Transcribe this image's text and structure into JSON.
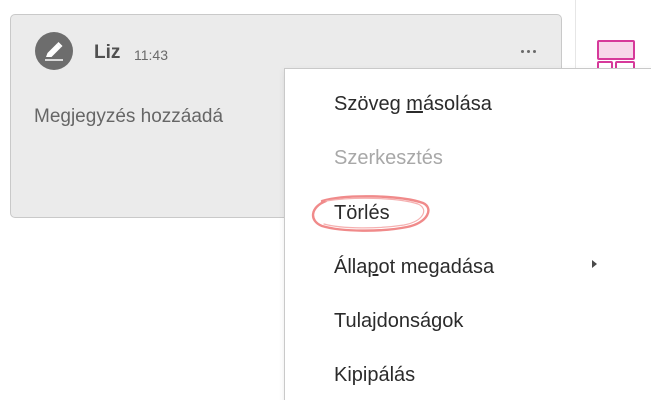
{
  "comment": {
    "author": "Liz",
    "time": "11:43",
    "text": "Megjegyzés hozzáadá",
    "avatar_icon": "pen-icon",
    "more_icon": "more-horizontal-icon"
  },
  "context_menu": {
    "items": [
      {
        "label_before": "Szöveg ",
        "mnemonic": "m",
        "label_after": "ásolása",
        "enabled": true
      },
      {
        "label": "Szerkesztés",
        "enabled": false
      },
      {
        "label": "Törlés",
        "enabled": true,
        "highlighted": true
      },
      {
        "label_before": "Álla",
        "mnemonic": "p",
        "label_after": "ot megadása",
        "enabled": true,
        "has_submenu": true
      },
      {
        "label": "Tulajdonságok",
        "enabled": true
      },
      {
        "label": "Kipipálás",
        "enabled": true
      }
    ]
  },
  "side_panel": {
    "icon": "comment-panel-icon",
    "accent_color": "#d6399a"
  },
  "colors": {
    "card_background": "#ebebeb",
    "highlight_circle": "#f08a8a"
  }
}
